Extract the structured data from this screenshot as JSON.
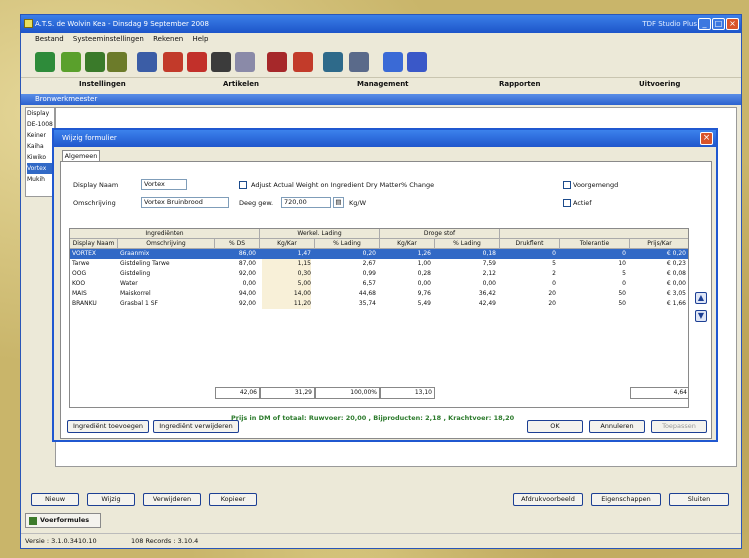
{
  "window": {
    "title": "A.T.S. de Wolvin Kea - Dinsdag 9 September 2008",
    "right_title": "TDF Studio Plus"
  },
  "menu": [
    "Bestand",
    "Systeeminstellingen",
    "Rekenen",
    "Help"
  ],
  "groups": [
    "Instellingen",
    "Artikelen",
    "Management",
    "Rapporten",
    "Uitvoering"
  ],
  "inner_window_title": "Bronwerkmeester",
  "left_list": [
    "Display",
    "DE-1008",
    "Keiner",
    "Kaiha",
    "Kiwiko",
    "Vortex",
    "Mukih"
  ],
  "left_list_selected": 5,
  "dialog": {
    "title": "Wijzig formulier",
    "tab": "Algemeen",
    "display_name_label": "Display Naam",
    "display_name": "Vortex",
    "description_label": "Omschrijving",
    "description": "Vortex Bruinbrood",
    "adjust_label": "Adjust Actual Weight on Ingredient Dry Matter% Change",
    "voorgemengd_label": "Voorgemengd",
    "dough_label": "Deeg gew.",
    "dough_value": "720,00",
    "dough_unit": "Kg/W",
    "actief_label": "Actief",
    "headers_group": [
      "Ingrediënten",
      "Werkel. Lading",
      "Droge stof"
    ],
    "headers": [
      "Display Naam",
      "Omschrijving",
      "% DS",
      "Kg/Kar",
      "% Lading",
      "Kg/Kar",
      "% Lading",
      "Drukflent",
      "Tolerantie",
      "Prijs/Kar"
    ],
    "rows": [
      [
        "VORTEX",
        "Graanmix",
        "86,00",
        "1,47",
        "0,20",
        "1,26",
        "0,18",
        "0",
        "0",
        "€ 0,20"
      ],
      [
        "Tarwe",
        "Gistdeling Tarwe",
        "87,00",
        "1,15",
        "2,67",
        "1,00",
        "7,59",
        "5",
        "10",
        "€ 0,23"
      ],
      [
        "OOG",
        "Gistdeling",
        "92,00",
        "0,30",
        "0,99",
        "0,28",
        "2,12",
        "2",
        "5",
        "€ 0,08"
      ],
      [
        "KOO",
        "Water",
        "0,00",
        "5,00",
        "6,57",
        "0,00",
        "0,00",
        "0",
        "0",
        "€ 0,00"
      ],
      [
        "MAIS",
        "Maiskorrel",
        "94,00",
        "14,00",
        "44,68",
        "9,76",
        "36,42",
        "20",
        "50",
        "€ 3,05"
      ],
      [
        "BRANKU",
        "Grasbal 1 SF",
        "92,00",
        "11,20",
        "35,74",
        "5,49",
        "42,49",
        "20",
        "50",
        "€ 1,66"
      ]
    ],
    "totals": [
      "42,06",
      "31,29",
      "100,00%",
      "13,10",
      "4,64"
    ],
    "summary": "Prijs in DM of totaal: Ruwvoer: 20,00 , Bijproducten: 2,18 , Krachtvoer: 18,20",
    "buttons_left": [
      "Ingrediënt toevoegen",
      "Ingrediënt verwijderen"
    ],
    "buttons_right": [
      "OK",
      "Annuleren",
      "Toepassen"
    ]
  },
  "bottom_buttons_left": [
    "Nieuw",
    "Wijzig",
    "Verwijderen",
    "Kopieer"
  ],
  "bottom_buttons_right": [
    "Afdrukvoorbeeld",
    "Eigenschappen",
    "Sluiten"
  ],
  "bottom_tab": "Voerformules",
  "status": {
    "version": "Versie : 3.1.0.3410.10",
    "records": "108 Records : 3.10.4"
  },
  "colors": {
    "titlebar": "#1d55c9",
    "selection": "#3169c6",
    "summary_text": "#2b7a2b"
  },
  "toolbar_icons": [
    "ration-icon",
    "plant-icon",
    "tool-icon",
    "wrench-icon",
    "grid-icon",
    "feed-icon",
    "feed2-icon",
    "truck-icon",
    "doc-icon",
    "car-icon",
    "car2-icon",
    "network-icon",
    "user-icon",
    "info-icon",
    "help-icon"
  ]
}
